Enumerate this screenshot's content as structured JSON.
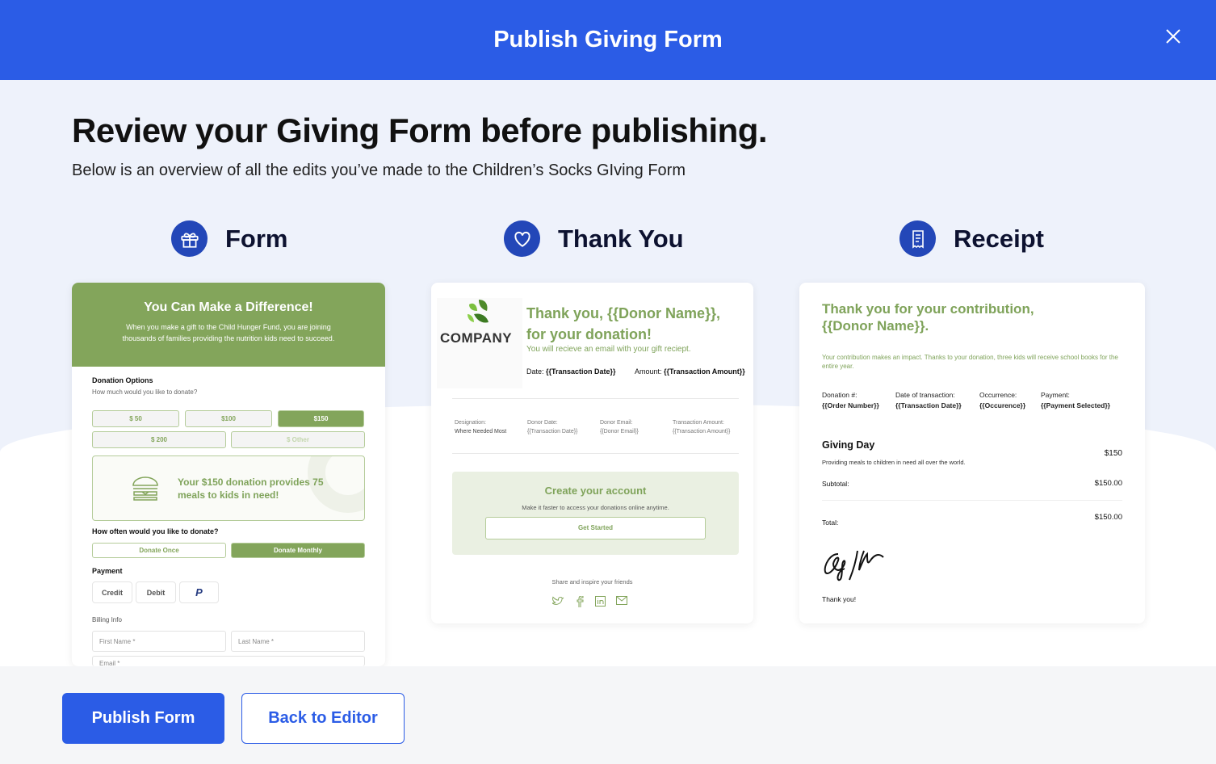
{
  "header": {
    "title": "Publish Giving Form",
    "close_icon": "close-icon"
  },
  "page": {
    "title": "Review your Giving Form before publishing.",
    "subtitle": "Below is an overview of all the edits you’ve made to the Children’s Socks GIving Form"
  },
  "sections": [
    {
      "label": "Form",
      "icon": "gift-icon"
    },
    {
      "label": "Thank You",
      "icon": "heart-icon"
    },
    {
      "label": "Receipt",
      "icon": "receipt-icon"
    }
  ],
  "colors": {
    "primary": "#2b5ce6",
    "accent_green": "#83a55b",
    "icon_bg": "#2347b8"
  },
  "form": {
    "headline": "You Can Make a Difference!",
    "intro_line1": "When you make a gift to the Child Hunger Fund, you are joining",
    "intro_line2": "thousands of families providing the nutrition kids need to succeed.",
    "donation_title": "Donation Options",
    "donation_question": "How much would you like to donate?",
    "amounts": [
      "$ 50",
      "$100",
      "$150",
      "$ 200",
      "$ Other"
    ],
    "selected_amount": "$150",
    "impact": "Your $150 donation provides 75 meals to kids in need!",
    "frequency_question": "How often would you like to donate?",
    "frequency": [
      "Donate Once",
      "Donate Monthly"
    ],
    "selected_frequency": "Donate Monthly",
    "payment_title": "Payment",
    "payment_options": [
      "Credit",
      "Debit",
      "PayPal"
    ],
    "billing_title": "Billing Info",
    "fields": {
      "first": "First Name *",
      "last": "Last Name *",
      "email": "Email *"
    }
  },
  "thankyou": {
    "logo_text": "COMPANY",
    "headline1": "Thank you, {{Donor Name}},",
    "headline2": "for your donation!",
    "email_note": "You will recieve an email with your gift reciept.",
    "date_label": "Date:",
    "date_value": "{{Transaction Date}}",
    "amount_label": "Amount:",
    "amount_value": "{{Transaction Amount}}",
    "details": [
      {
        "label": "Designation:",
        "value": "Where Needed Most"
      },
      {
        "label": "Donor Date:",
        "value": "{{Transaction Date}}"
      },
      {
        "label": "Donor Email:",
        "value": "{{Donor Email}}"
      },
      {
        "label": "Transaction Amount:",
        "value": "{{Transaction Amount}}"
      }
    ],
    "account_title": "Create your account",
    "account_text": "Make it faster to access your donations online anytime.",
    "account_button": "Get Started",
    "share_text": "Share and inspire your friends",
    "social": [
      "twitter-icon",
      "facebook-icon",
      "linkedin-icon",
      "mail-icon"
    ]
  },
  "receipt": {
    "headline1": "Thank you for your contribution,",
    "headline2": "{{Donor Name}}.",
    "impact": "Your contribution makes an impact. Thanks to your donation, three kids will receive school books for the entire year.",
    "fields": [
      {
        "label": "Donation #:",
        "value": "{{Order Number}}"
      },
      {
        "label": "Date of transaction:",
        "value": "{{Transaction Date}}"
      },
      {
        "label": "Occurrence:",
        "value": "{{Occurence}}"
      },
      {
        "label": "Payment:",
        "value": "{{Payment Selected}}"
      }
    ],
    "item_title": "Giving Day",
    "item_desc": "Providing meals to children in need all over the world.",
    "item_amount": "$150",
    "subtotal_label": "Subtotal:",
    "subtotal": "$150.00",
    "total_label": "Total:",
    "total": "$150.00",
    "closing": "Thank you!"
  },
  "actions": {
    "publish": "Publish Form",
    "back": "Back to Editor"
  }
}
